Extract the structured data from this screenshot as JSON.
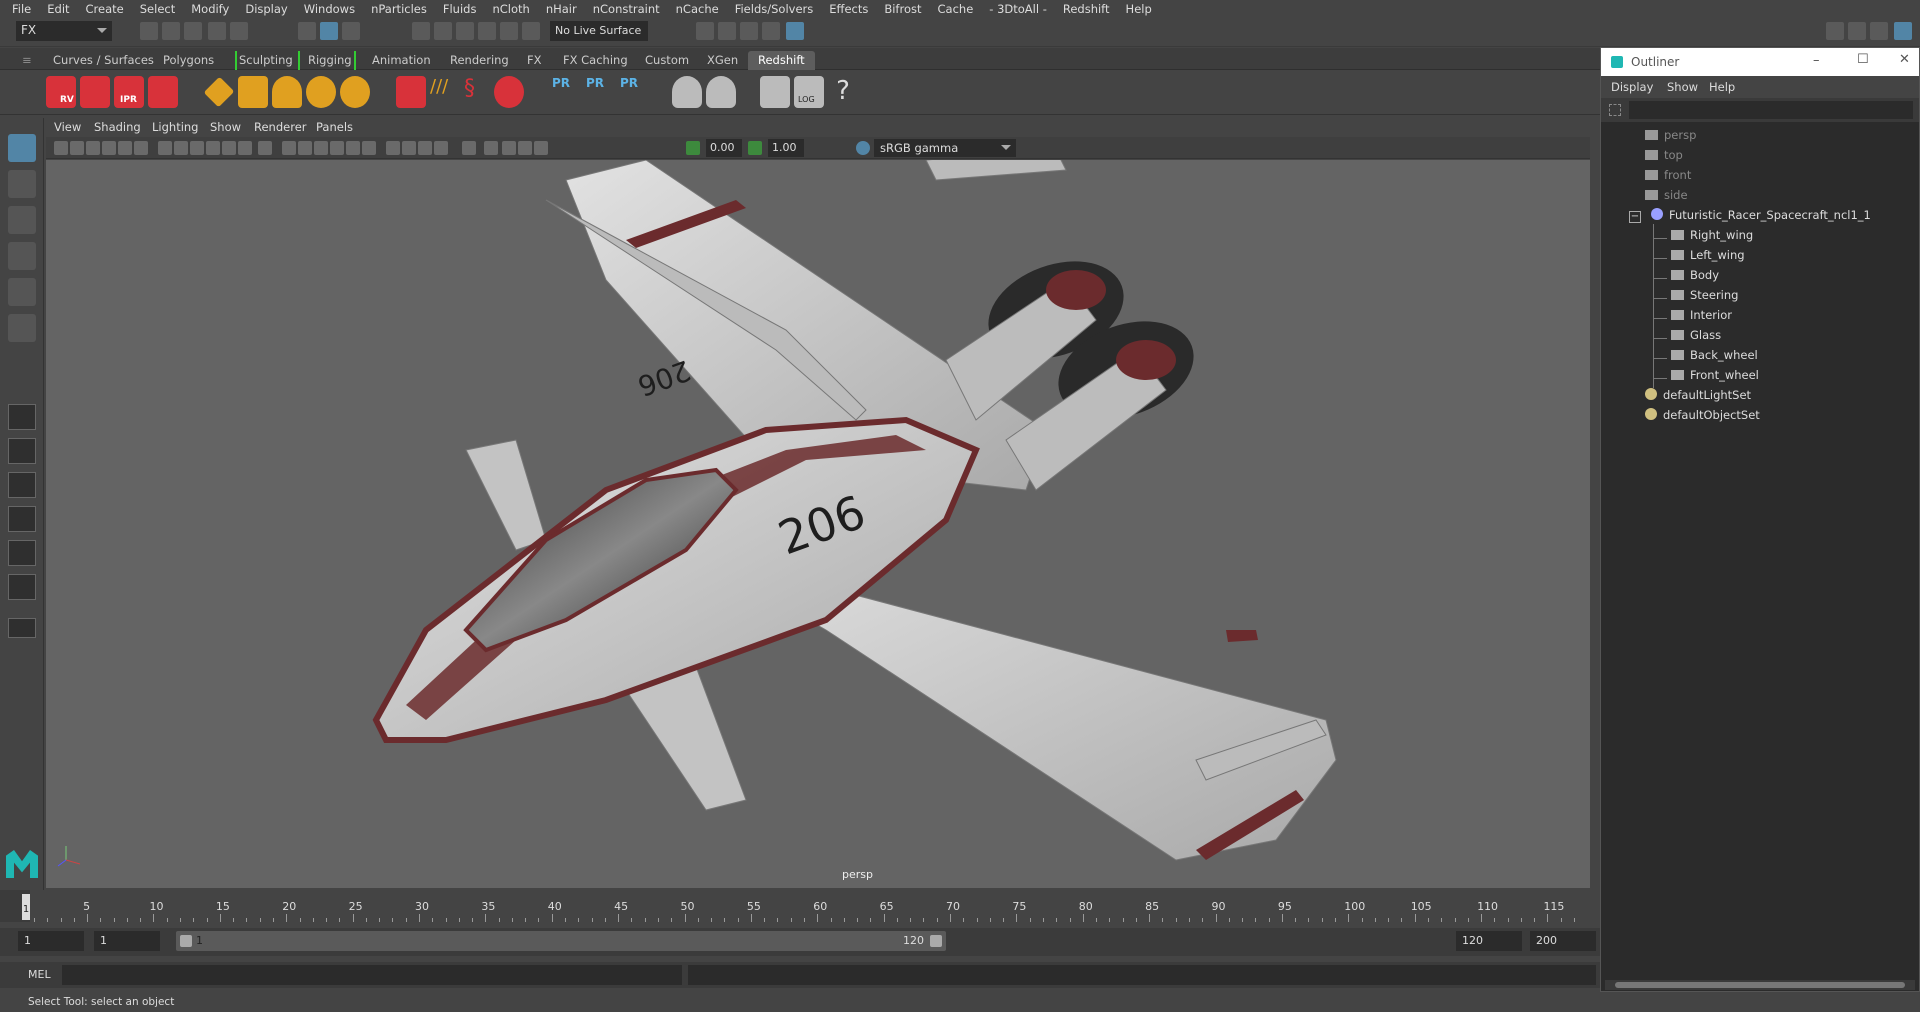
{
  "menubar": [
    "File",
    "Edit",
    "Create",
    "Select",
    "Modify",
    "Display",
    "Windows",
    "nParticles",
    "Fluids",
    "nCloth",
    "nHair",
    "nConstraint",
    "nCache",
    "Fields/Solvers",
    "Effects",
    "Bifrost",
    "Cache",
    "- 3DtoAll -",
    "Redshift",
    "Help"
  ],
  "status": {
    "mode": "FX",
    "live_surface": "No Live Surface"
  },
  "shelf_tabs": [
    "Curves / Surfaces",
    "Polygons",
    "Sculpting",
    "Rigging",
    "Animation",
    "Rendering",
    "FX",
    "FX Caching",
    "Custom",
    "XGen",
    "Redshift"
  ],
  "active_shelf_tab": "Redshift",
  "shelf_icon_labels": {
    "rv": "RV",
    "ipr": "IPR",
    "pr": "PR",
    "log": "LOG",
    "help": "?"
  },
  "viewport_menu": [
    "View",
    "Shading",
    "Lighting",
    "Show",
    "Renderer",
    "Panels"
  ],
  "viewport_values": {
    "exposure": "0.00",
    "gamma": "1.00",
    "color_space": "sRGB gamma"
  },
  "viewport_label": "persp",
  "model_numbers": [
    "206",
    "206"
  ],
  "timeline": {
    "ticks": [
      "5",
      "10",
      "15",
      "20",
      "25",
      "30",
      "35",
      "40",
      "45",
      "50",
      "55",
      "60",
      "65",
      "70",
      "75",
      "80",
      "85",
      "90",
      "95",
      "100",
      "105",
      "110",
      "115"
    ],
    "current_frame": "1"
  },
  "range": {
    "start": "1",
    "anim_start": "1",
    "slider_start": "1",
    "slider_end": "120",
    "anim_end": "120",
    "end": "200"
  },
  "mel_label": "MEL",
  "help_line": "Select Tool: select an object",
  "outliner": {
    "title": "Outliner",
    "menu": [
      "Display",
      "Show",
      "Help"
    ],
    "items": [
      {
        "label": "persp",
        "level": 0,
        "type": "camera",
        "dim": true
      },
      {
        "label": "top",
        "level": 0,
        "type": "camera",
        "dim": true
      },
      {
        "label": "front",
        "level": 0,
        "type": "camera",
        "dim": true
      },
      {
        "label": "side",
        "level": 0,
        "type": "camera",
        "dim": true
      },
      {
        "label": "Futuristic_Racer_Spacecraft_ncl1_1",
        "level": 0,
        "type": "group",
        "dim": false
      },
      {
        "label": "Right_wing",
        "level": 1,
        "type": "mesh",
        "dim": false
      },
      {
        "label": "Left_wing",
        "level": 1,
        "type": "mesh",
        "dim": false
      },
      {
        "label": "Body",
        "level": 1,
        "type": "mesh",
        "dim": false
      },
      {
        "label": "Steering",
        "level": 1,
        "type": "mesh",
        "dim": false
      },
      {
        "label": "Interior",
        "level": 1,
        "type": "mesh",
        "dim": false
      },
      {
        "label": "Glass",
        "level": 1,
        "type": "mesh",
        "dim": false
      },
      {
        "label": "Back_wheel",
        "level": 1,
        "type": "mesh",
        "dim": false
      },
      {
        "label": "Front_wheel",
        "level": 1,
        "type": "mesh",
        "dim": false
      },
      {
        "label": "defaultLightSet",
        "level": 0,
        "type": "set",
        "dim": false
      },
      {
        "label": "defaultObjectSet",
        "level": 0,
        "type": "set",
        "dim": false
      }
    ]
  },
  "colors": {
    "accent": "#5285a6",
    "stripe": "#6b2b2d",
    "hull": "#c9c9c9",
    "viewport_bg": "#646464"
  }
}
